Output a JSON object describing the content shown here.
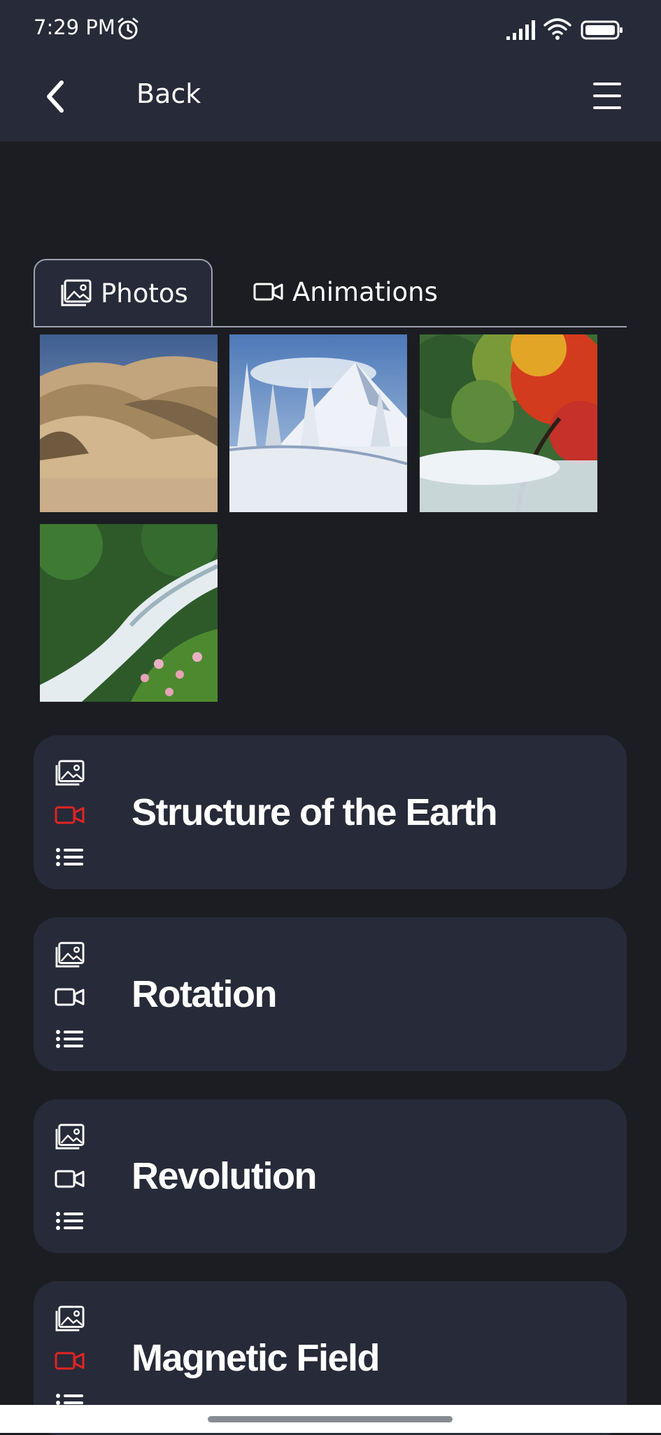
{
  "status_bar": {
    "time": "7:29 PM",
    "icons": [
      "alarm-icon",
      "signal-icon",
      "wifi-icon",
      "battery-icon"
    ]
  },
  "header": {
    "back_label": "Back",
    "back_icon": "chevron-left-icon",
    "menu_icon": "hamburger-menu-icon"
  },
  "tabs": [
    {
      "label": "Photos",
      "icon": "image-icon",
      "active": true
    },
    {
      "label": "Animations",
      "icon": "video-icon",
      "active": false
    }
  ],
  "photos": [
    {
      "subject": "sand-dunes"
    },
    {
      "subject": "snowy-mountain"
    },
    {
      "subject": "autumn-tree-mist"
    },
    {
      "subject": "forest-stream-flowers"
    }
  ],
  "topics": [
    {
      "title": "Structure of the Earth",
      "video_highlighted": true
    },
    {
      "title": "Rotation",
      "video_highlighted": false
    },
    {
      "title": "Revolution",
      "video_highlighted": false
    },
    {
      "title": "Magnetic Field",
      "video_highlighted": true
    }
  ],
  "colors": {
    "background": "#1c1d22",
    "header": "#272a38",
    "card": "#272a38",
    "accent_red": "#e02424",
    "text": "#ffffff"
  }
}
